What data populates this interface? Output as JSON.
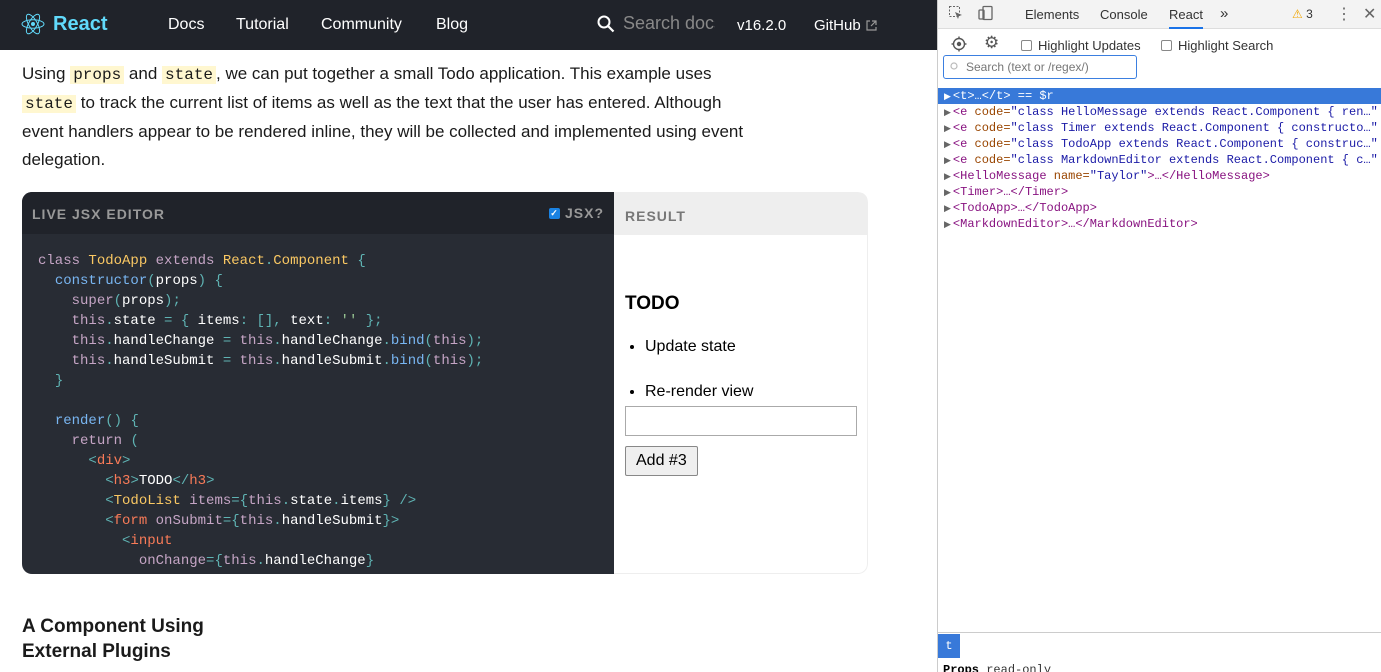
{
  "site": {
    "brand": "React",
    "nav": [
      "Docs",
      "Tutorial",
      "Community",
      "Blog"
    ],
    "search_placeholder": "Search docs",
    "version": "v16.2.0",
    "github": "GitHub",
    "intro": {
      "p1": "Using ",
      "c1": "props",
      "p2": " and ",
      "c2": "state",
      "p3": ", we can put together a small Todo application. This example uses ",
      "c3": "state",
      "p4": " to track the current list of items as well as the text that the user has entered. Although event handlers appear to be rendered inline, they will be collected and implemented using event delegation."
    },
    "editor": {
      "header": "LIVE JSX EDITOR",
      "jsx_label": "JSX?",
      "jsx_checked": true,
      "result_header": "RESULT"
    },
    "result": {
      "title": "TODO",
      "items": [
        "Update state",
        "Re-render view"
      ],
      "input_value": "",
      "button": "Add #3"
    },
    "subheading": "A Component Using External Plugins"
  },
  "devtools": {
    "tabs": [
      "Elements",
      "Console",
      "React"
    ],
    "active_tab": "React",
    "more": "»",
    "warnings": "3",
    "highlight_updates": "Highlight Updates",
    "highlight_search": "Highlight Search",
    "search_placeholder": "Search (text or /regex/)",
    "tree": [
      {
        "open": "<t>",
        "rest": "…</t> == $r",
        "selected": true
      },
      {
        "tag": "<e",
        "attr": " code=",
        "val": "\"class HelloMessage extends React.Component { ren…\""
      },
      {
        "tag": "<e",
        "attr": " code=",
        "val": "\"class Timer extends React.Component { constructo…\""
      },
      {
        "tag": "<e",
        "attr": " code=",
        "val": "\"class TodoApp extends React.Component { construc…\""
      },
      {
        "tag": "<e",
        "attr": " code=",
        "val": "\"class MarkdownEditor extends React.Component { c…\""
      },
      {
        "tag": "<HelloMessage",
        "attr": " name=",
        "val": "\"Taylor\"",
        "tail": ">…</HelloMessage>"
      },
      {
        "tag": "<Timer>",
        "tail": "…</Timer>"
      },
      {
        "tag": "<TodoApp>",
        "tail": "…</TodoApp>"
      },
      {
        "tag": "<MarkdownEditor>",
        "tail": "…</MarkdownEditor>"
      }
    ],
    "bottom_tab": "t",
    "props_label": "Props",
    "props_note": "read-only"
  }
}
